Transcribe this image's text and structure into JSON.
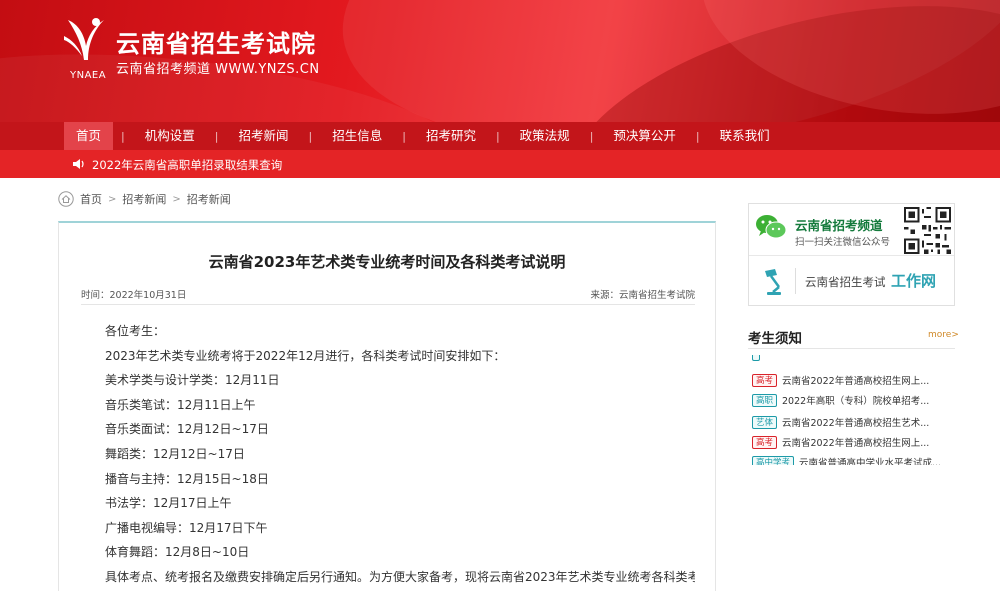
{
  "header": {
    "site_title": "云南省招生考试院",
    "site_subtitle": "云南省招考频道 WWW.YNZS.CN",
    "logo_abbr": "YNAEA",
    "colors": {
      "primary": "#c3151a",
      "accent": "#e42426"
    }
  },
  "nav": {
    "items": [
      {
        "label": "首页",
        "active": true
      },
      {
        "label": "机构设置"
      },
      {
        "label": "招考新闻"
      },
      {
        "label": "招生信息"
      },
      {
        "label": "招考研究"
      },
      {
        "label": "政策法规"
      },
      {
        "label": "预决算公开"
      },
      {
        "label": "联系我们"
      }
    ],
    "separator": "|"
  },
  "notice": {
    "icon": "speaker-icon",
    "text": "2022年云南省高职单招录取结果查询"
  },
  "breadcrumb": {
    "icon": "home-icon",
    "items": [
      "首页",
      "招考新闻",
      "招考新闻"
    ],
    "separator": ">"
  },
  "article": {
    "title": "云南省2023年艺术类专业统考时间及各科类考试说明",
    "time": "时间：2022年10月31日",
    "source": "来源：云南省招生考试院",
    "lines": [
      "各位考生：",
      "2023年艺术类专业统考将于2022年12月进行，各科类考试时间安排如下：",
      "美术学类与设计学类：12月11日",
      "音乐类笔试：12月11日上午",
      "音乐类面试：12月12日~17日",
      "舞蹈类：12月12日~17日",
      "播音与主持：12月15日~18日",
      "书法学：12月17日上午",
      "广播电视编导：12月17日下午",
      "体育舞蹈：12月8日~10日",
      "具体考点、统考报名及缴费安排确定后另行通知。为方便大家备考，现将云南省2023年艺术类专业统考各科类考"
    ]
  },
  "sidebar": {
    "wechat": {
      "icon": "wechat-icon",
      "title": "云南省招考频道",
      "subtitle": "扫一扫关注微信公众号",
      "qr_icon": "qr-code-icon"
    },
    "work": {
      "icon": "desk-lamp-icon",
      "label": "云南省招生考试",
      "highlight": "工作网"
    },
    "section": {
      "title": "考生须知",
      "more": "more>",
      "items": [
        {
          "tag": "",
          "text": "",
          "style": "teal"
        },
        {
          "tag": "高考",
          "text": "云南省2022年普通高校招生网上...",
          "style": "red"
        },
        {
          "tag": "高职",
          "text": "2022年高职（专科）院校单招考...",
          "style": "teal"
        },
        {
          "tag": "艺体",
          "text": "云南省2022年普通高校招生艺术...",
          "style": "teal"
        },
        {
          "tag": "高考",
          "text": "云南省2022年普通高校招生网上...",
          "style": "red"
        },
        {
          "tag": "高中学考",
          "text": "云南省普通高中学业水平考试成...",
          "style": "teal"
        }
      ]
    }
  }
}
